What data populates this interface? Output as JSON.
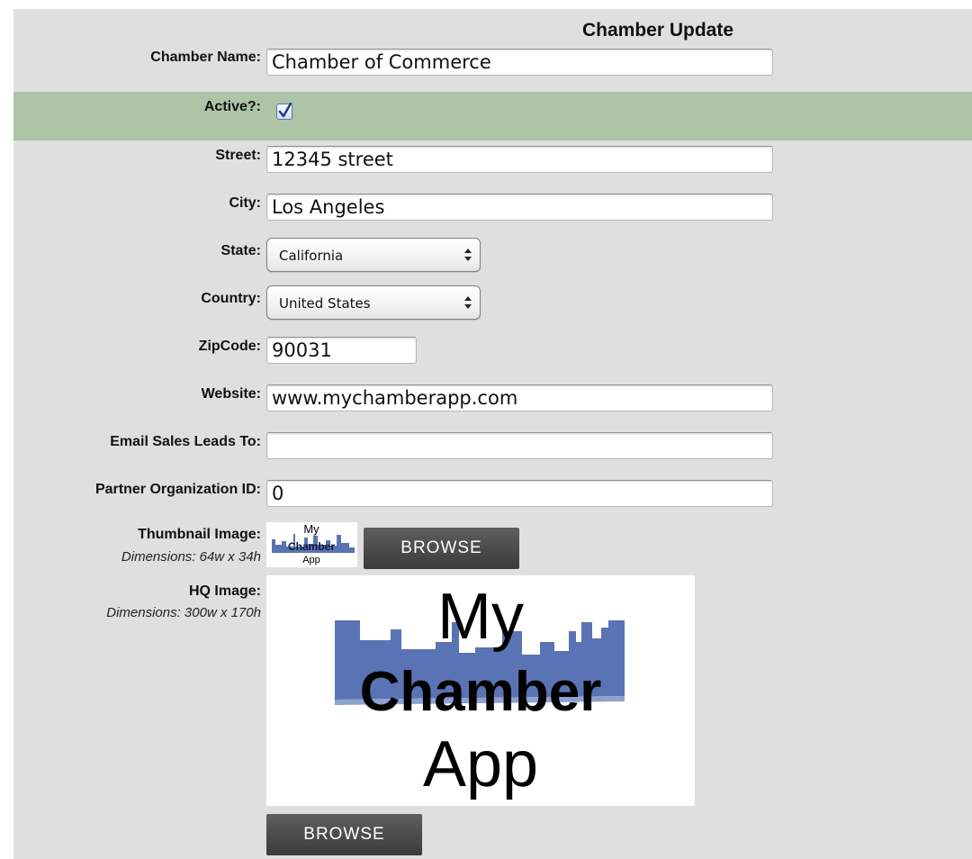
{
  "form": {
    "title": "Chamber Update",
    "chamber_name": {
      "label": "Chamber Name:",
      "value": "Chamber of Commerce"
    },
    "active": {
      "label": "Active?:",
      "checked": true
    },
    "street": {
      "label": "Street:",
      "value": "12345 street"
    },
    "city": {
      "label": "City:",
      "value": "Los Angeles"
    },
    "state": {
      "label": "State:",
      "value": "California"
    },
    "country": {
      "label": "Country:",
      "value": "United States"
    },
    "zipcode": {
      "label": "ZipCode:",
      "value": "90031"
    },
    "website": {
      "label": "Website:",
      "value": "www.mychamberapp.com"
    },
    "email_sales_leads": {
      "label": "Email Sales Leads To:",
      "value": ""
    },
    "partner_org_id": {
      "label": "Partner Organization ID:",
      "value": "0"
    },
    "thumbnail": {
      "label": "Thumbnail Image:",
      "dimensions": "Dimensions: 64w x 34h",
      "browse_label": "BROWSE",
      "logo_lines": [
        "My",
        "Chamber",
        "App"
      ]
    },
    "hq_image": {
      "label": "HQ Image:",
      "dimensions": "Dimensions: 300w x 170h",
      "browse_label": "BROWSE",
      "logo_lines": [
        "My",
        "Chamber",
        "App"
      ]
    }
  },
  "colors": {
    "panel_bg": "#dfdfdf",
    "active_row_bg": "#adc4a7",
    "skyline_blue": "#5a73b4",
    "button_dark": "#4a4a4a"
  },
  "icons": {
    "checkbox": "check-icon",
    "select_arrows": "up-down-arrows-icon"
  }
}
